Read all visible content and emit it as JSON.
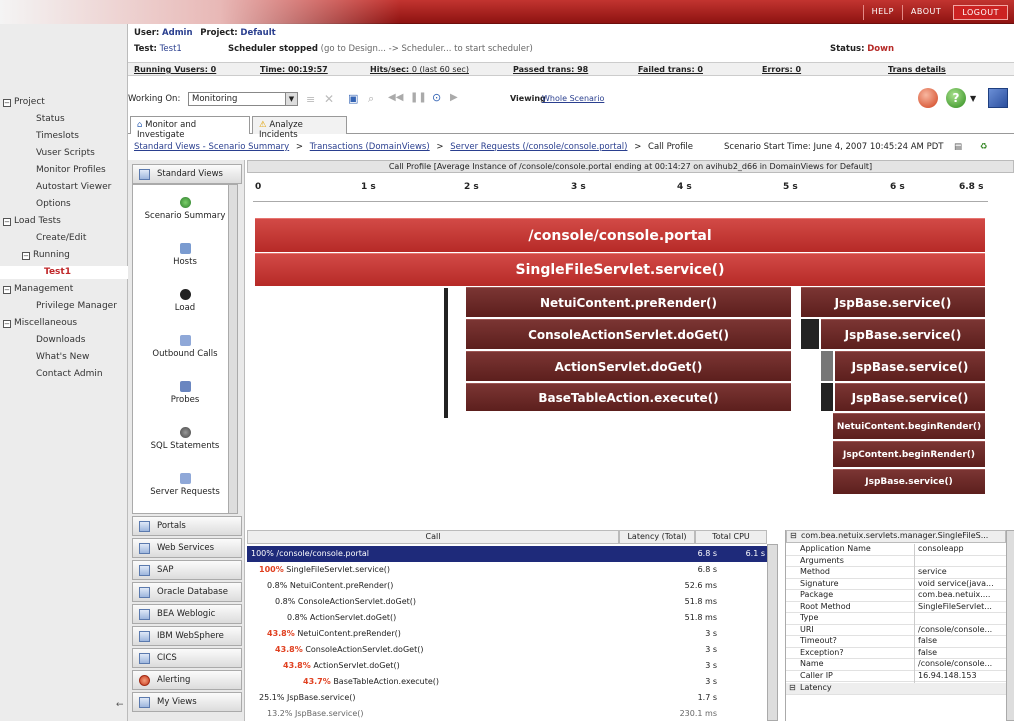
{
  "topbar": {
    "help": "HELP",
    "about": "ABOUT",
    "logout": "LOGOUT"
  },
  "header": {
    "user_label": "User:",
    "user": "Admin",
    "project_label": "Project:",
    "project": "Default",
    "test_label": "Test:",
    "test": "Test1",
    "scheduler": "Scheduler stopped",
    "scheduler_hint": "(go to Design... -> Scheduler... to start scheduler)",
    "status_label": "Status:",
    "status": "Down"
  },
  "stats": {
    "vusers": "Running Vusers: 0",
    "time": "Time: 00:19:57",
    "hits": "Hits/sec:",
    "hits_val": "0 (last 60 sec)",
    "passed": "Passed trans: 98",
    "failed": "Failed trans: 0",
    "errors": "Errors: 0",
    "trans_details": "Trans details"
  },
  "toolbar": {
    "working_on": "Working On:",
    "working_value": "Monitoring",
    "viewing": "Viewing",
    "viewing_link": "Whole Scenario"
  },
  "tabs": [
    "Monitor and Investigate",
    "Analyze Incidents"
  ],
  "breadcrumb": {
    "items": [
      "Standard Views - Scenario Summary",
      "Transactions (DomainViews)",
      "Server Requests (/console/console.portal)"
    ],
    "current": "Call Profile",
    "sep": ">",
    "start_time": "Scenario Start Time: June 4, 2007 10:45:24 AM PDT"
  },
  "leftnav": {
    "project": "Project",
    "status": "Status",
    "timeslots": "Timeslots",
    "vuser_scripts": "Vuser Scripts",
    "monitor_profiles": "Monitor Profiles",
    "autostart": "Autostart Viewer",
    "options": "Options",
    "load_tests": "Load Tests",
    "create_edit": "Create/Edit",
    "running": "Running",
    "test1": "Test1",
    "management": "Management",
    "privilege": "Privilege Manager",
    "misc": "Miscellaneous",
    "downloads": "Downloads",
    "whats_new": "What's New",
    "contact": "Contact Admin"
  },
  "sidebar": {
    "standard_views": "Standard Views",
    "views": [
      "Scenario Summary",
      "Hosts",
      "Load",
      "Outbound Calls",
      "Probes",
      "SQL Statements",
      "Server Requests"
    ],
    "groups": [
      "Portals",
      "Web Services",
      "SAP",
      "Oracle Database",
      "BEA Weblogic",
      "IBM WebSphere",
      "CICS",
      "Alerting",
      "My Views"
    ]
  },
  "callprofile": {
    "title": "Call Profile [Average Instance of /console/console.portal ending at 00:14:27 on avihub2_d66 in DomainViews for Default]",
    "ticks": [
      "0",
      "1 s",
      "2 s",
      "3 s",
      "4 s",
      "5 s",
      "6 s",
      "6.8 s"
    ],
    "bars": {
      "b1": "/console/console.portal",
      "b2": "SingleFileServlet.service()",
      "b3": "NetuiContent.preRender()",
      "b4": "ConsoleActionServlet.doGet()",
      "b5": "ActionServlet.doGet()",
      "b6": "BaseTableAction.execute()",
      "j1": "JspBase.service()",
      "j2": "JspBase.service()",
      "j3": "JspBase.service()",
      "j4": "JspBase.service()",
      "n1": "NetuiContent.beginRender()",
      "n2": "JspContent.beginRender()",
      "n3": "JspBase.service()"
    }
  },
  "grid": {
    "headers": {
      "call": "Call",
      "latency": "Latency (Total)",
      "cpu": "Total CPU"
    },
    "rows": [
      {
        "pct": "100%",
        "name": "/console/console.portal",
        "latency": "6.8 s",
        "cpu": "6.1 s"
      },
      {
        "pct": "100%",
        "name": "SingleFileServlet.service()",
        "latency": "6.8 s"
      },
      {
        "pct": "0.8%",
        "name": "NetuiContent.preRender()",
        "latency": "52.6 ms"
      },
      {
        "pct": "0.8%",
        "name": "ConsoleActionServlet.doGet()",
        "latency": "51.8 ms"
      },
      {
        "pct": "0.8%",
        "name": "ActionServlet.doGet()",
        "latency": "51.8 ms"
      },
      {
        "pct": "43.8%",
        "name": "NetuiContent.preRender()",
        "latency": "3 s"
      },
      {
        "pct": "43.8%",
        "name": "ConsoleActionServlet.doGet()",
        "latency": "3 s"
      },
      {
        "pct": "43.8%",
        "name": "ActionServlet.doGet()",
        "latency": "3 s"
      },
      {
        "pct": "43.7%",
        "name": "BaseTableAction.execute()",
        "latency": "3 s"
      },
      {
        "pct": "25.1%",
        "name": "JspBase.service()",
        "latency": "1.7 s"
      },
      {
        "pct": "13.2%",
        "name": "JspBase.service()",
        "latency": "230.1 ms"
      }
    ]
  },
  "props": {
    "title": "com.bea.netuix.servlets.manager.SingleFileS...",
    "rows": [
      {
        "k": "Application Name",
        "v": "consoleapp"
      },
      {
        "k": "Arguments",
        "v": ""
      },
      {
        "k": "Method",
        "v": "service"
      },
      {
        "k": "Signature",
        "v": "void service(java..."
      },
      {
        "k": "Package",
        "v": "com.bea.netuix...."
      },
      {
        "k": "Root Method",
        "v": "SingleFileServlet..."
      },
      {
        "k": "Type",
        "v": ""
      },
      {
        "k": "URI",
        "v": "/console/console..."
      },
      {
        "k": "Timeout?",
        "v": "false"
      },
      {
        "k": "Exception?",
        "v": "false"
      },
      {
        "k": "Name",
        "v": "/console/console..."
      },
      {
        "k": "Caller IP",
        "v": "16.94.148.153"
      }
    ],
    "latency": "Latency"
  },
  "colors": {
    "accent_red": "#b62a27",
    "dark_bar": "#5c1f1d",
    "link_blue": "#2a3f8f",
    "selected_row": "#1e2a7a"
  }
}
